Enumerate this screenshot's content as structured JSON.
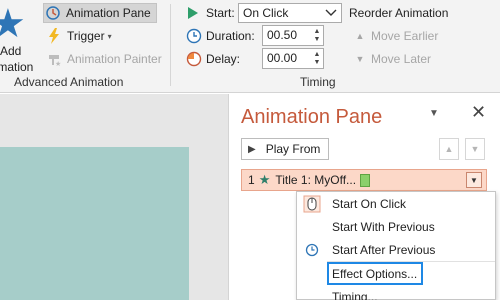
{
  "ribbon": {
    "add_animation": {
      "line1": "Add",
      "line2": "nimation",
      "icon": "star-icon"
    },
    "advanced": {
      "animation_pane": "Animation Pane",
      "trigger": "Trigger",
      "animation_painter": "Animation Painter",
      "group_label": "Advanced Animation"
    },
    "timing": {
      "start_label": "Start:",
      "start_value": "On Click",
      "duration_label": "Duration:",
      "duration_value": "00.50",
      "delay_label": "Delay:",
      "delay_value": "00.00",
      "group_label": "Timing"
    },
    "reorder": {
      "title": "Reorder Animation",
      "move_earlier": "Move Earlier",
      "move_later": "Move Later"
    }
  },
  "pane": {
    "title": "Animation Pane",
    "play_from": "Play From",
    "items": [
      {
        "number": "1",
        "label": "Title 1: MyOff..."
      }
    ]
  },
  "context_menu": {
    "items": [
      {
        "label": "Start On Click",
        "icon": "mouse-click-icon"
      },
      {
        "label": "Start With Previous",
        "icon": ""
      },
      {
        "label": "Start After Previous",
        "icon": "clock-icon"
      },
      {
        "label": "Effect Options...",
        "icon": ""
      },
      {
        "label": "Timing...",
        "icon": ""
      }
    ]
  },
  "colors": {
    "accent_blue": "#2e75b6",
    "pane_title": "#c55a3c",
    "selected_item": "#fcd8c8",
    "slide": "#a6cdc9",
    "focus": "#1e88e5"
  }
}
